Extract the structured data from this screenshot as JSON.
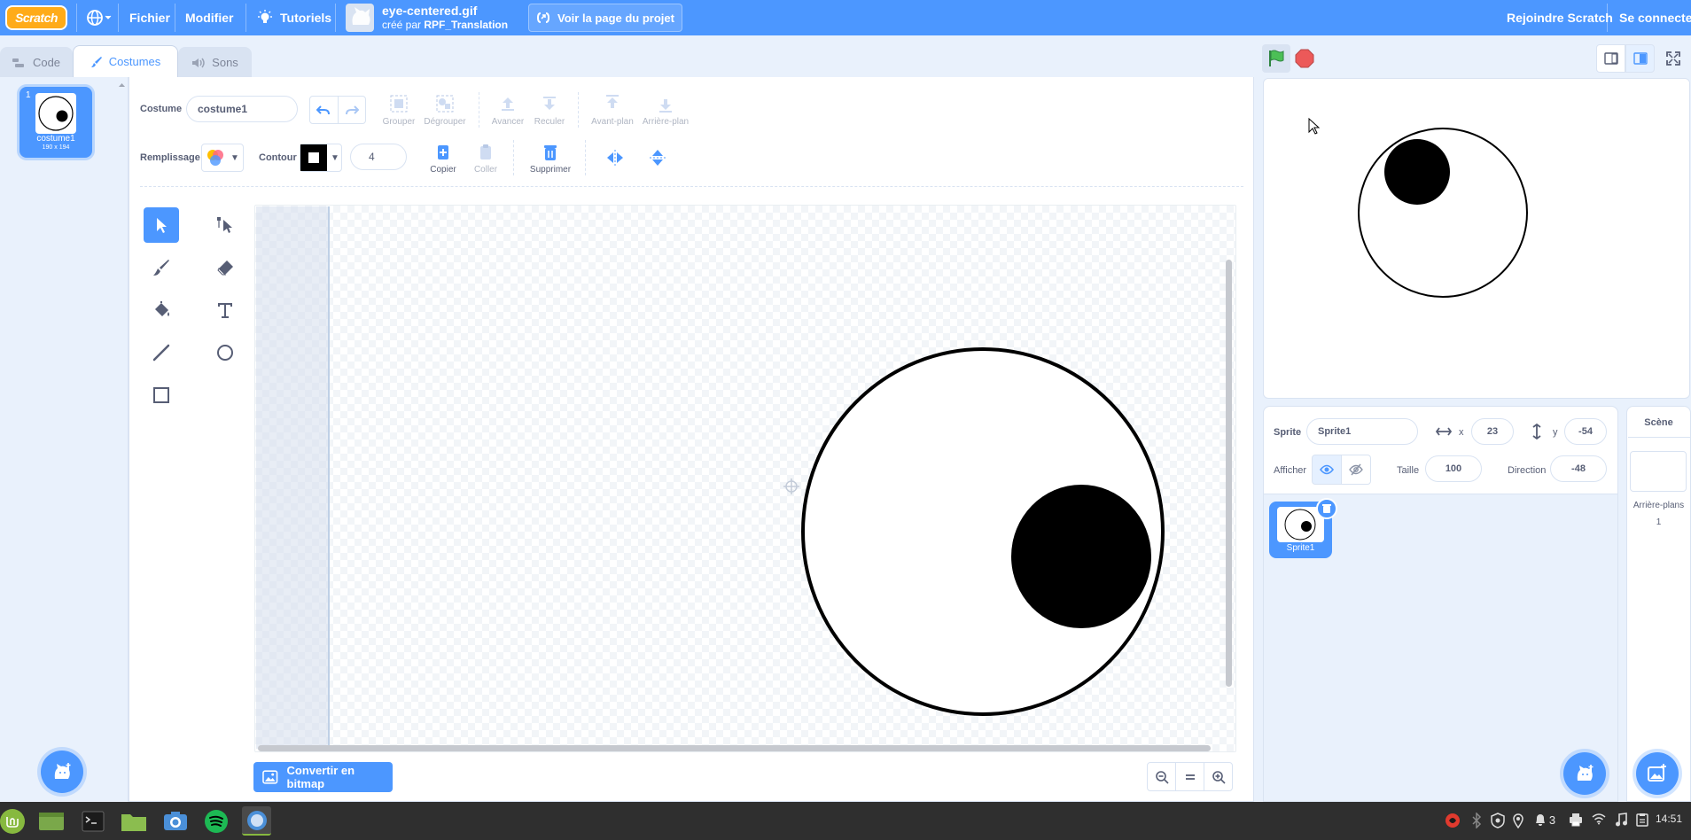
{
  "menubar": {
    "logo": "Scratch",
    "file": "Fichier",
    "edit": "Modifier",
    "tutorials": "Tutoriels",
    "project_title": "eye-centered.gif",
    "created_by_prefix": "créé par",
    "author": "RPF_Translation",
    "see_project": "Voir la page du projet",
    "join": "Rejoindre Scratch",
    "sign_in": "Se connecter"
  },
  "tabs": [
    {
      "label": "Code",
      "icon": "code-icon"
    },
    {
      "label": "Costumes",
      "icon": "brush-icon"
    },
    {
      "label": "Sons",
      "icon": "speaker-icon"
    }
  ],
  "costume_list": [
    {
      "number": "1",
      "name": "costume1",
      "dims": "190 x 194"
    }
  ],
  "paint_editor": {
    "costume_label": "Costume",
    "costume_name": "costume1",
    "group": "Grouper",
    "ungroup": "Dégrouper",
    "forward": "Avancer",
    "backward": "Reculer",
    "front": "Avant-plan",
    "back": "Arrière-plan",
    "fill_label": "Remplissage",
    "outline_label": "Contour",
    "outline_width": "4",
    "copy": "Copier",
    "paste": "Coller",
    "delete": "Supprimer",
    "convert_bitmap": "Convertir en bitmap"
  },
  "sprite_info": {
    "sprite_label": "Sprite",
    "sprite_name": "Sprite1",
    "x_label": "x",
    "x": "23",
    "y_label": "y",
    "y": "-54",
    "show_label": "Afficher",
    "size_label": "Taille",
    "size": "100",
    "direction_label": "Direction",
    "direction": "-48"
  },
  "sprites": [
    {
      "name": "Sprite1"
    }
  ],
  "stage_pane": {
    "title": "Scène",
    "backdrops_label": "Arrière-plans",
    "backdrops_count": "1"
  },
  "taskbar": {
    "notifications": "3",
    "clock": "14:51"
  },
  "colors": {
    "accent": "#4c97ff",
    "background": "#e9f1fc",
    "text": "#575e75",
    "taskbar": "#2f2f2f"
  }
}
